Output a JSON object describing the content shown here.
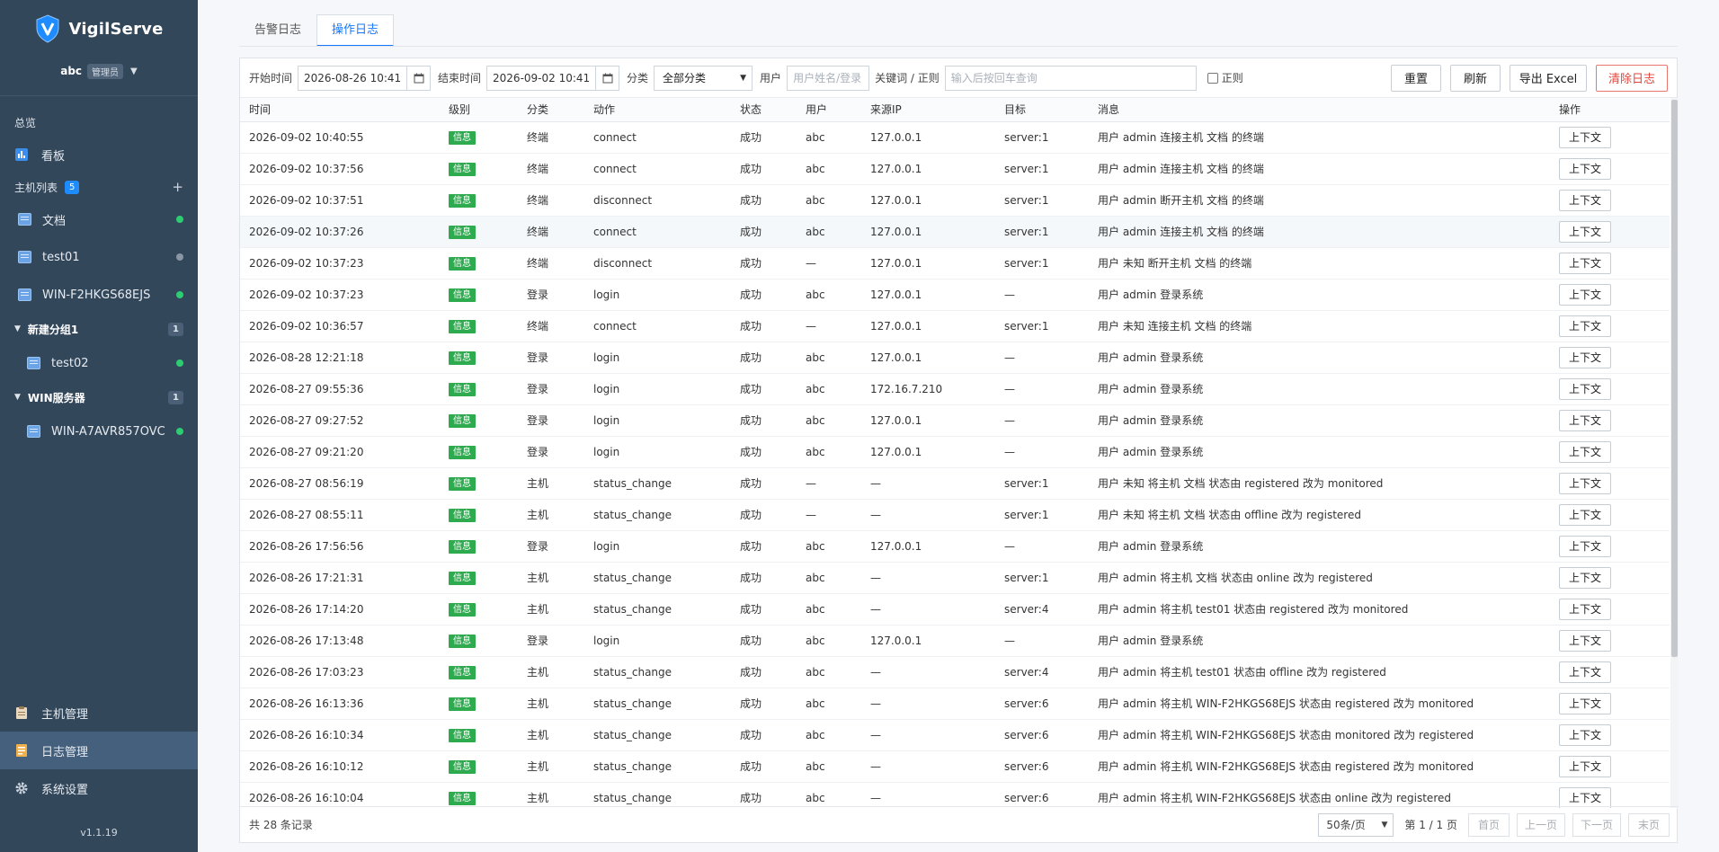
{
  "app": {
    "name": "VigilServe",
    "version": "v1.1.19"
  },
  "user": {
    "name": "abc",
    "role": "管理员"
  },
  "sidebar": {
    "overview_title": "总览",
    "dashboard_label": "看板",
    "hosts_title": "主机列表",
    "hosts_count": "5",
    "add_symbol": "+",
    "hosts": [
      {
        "name": "文档",
        "status": "online"
      },
      {
        "name": "test01",
        "status": "offline"
      },
      {
        "name": "WIN-F2HKGS68EJS",
        "status": "online"
      }
    ],
    "groups": [
      {
        "name": "新建分组1",
        "count": "1",
        "hosts": [
          {
            "name": "test02",
            "status": "online"
          }
        ]
      },
      {
        "name": "WIN服务器",
        "count": "1",
        "hosts": [
          {
            "name": "WIN-A7AVR857OVC",
            "status": "online"
          }
        ]
      }
    ],
    "bottom": [
      {
        "label": "主机管理",
        "icon": "clipboard-icon",
        "active": false
      },
      {
        "label": "日志管理",
        "icon": "log-icon",
        "active": true
      },
      {
        "label": "系统设置",
        "icon": "gear-icon",
        "active": false
      }
    ]
  },
  "tabs": [
    {
      "label": "告警日志",
      "active": false
    },
    {
      "label": "操作日志",
      "active": true
    }
  ],
  "filters": {
    "start_label": "开始时间",
    "start_value": "2026-08-26 10:41",
    "end_label": "结束时间",
    "end_value": "2026-09-02 10:41",
    "category_label": "分类",
    "category_value": "全部分类",
    "user_label": "用户",
    "user_placeholder": "用户姓名/登录",
    "keyword_label": "关键词 / 正则",
    "keyword_placeholder": "输入后按回车查询",
    "regex_label": "正则",
    "buttons": {
      "reset": "重置",
      "refresh": "刷新",
      "export": "导出 Excel",
      "clear": "清除日志"
    }
  },
  "table": {
    "columns": [
      "时间",
      "级别",
      "分类",
      "动作",
      "状态",
      "用户",
      "来源IP",
      "目标",
      "消息",
      "操作"
    ],
    "context_label": "上下文",
    "rows": [
      [
        "2026-09-02 10:40:55",
        "信息",
        "终端",
        "connect",
        "成功",
        "abc",
        "127.0.0.1",
        "server:1",
        "用户 admin 连接主机 文档 的终端"
      ],
      [
        "2026-09-02 10:37:56",
        "信息",
        "终端",
        "connect",
        "成功",
        "abc",
        "127.0.0.1",
        "server:1",
        "用户 admin 连接主机 文档 的终端"
      ],
      [
        "2026-09-02 10:37:51",
        "信息",
        "终端",
        "disconnect",
        "成功",
        "abc",
        "127.0.0.1",
        "server:1",
        "用户 admin 断开主机 文档 的终端"
      ],
      [
        "2026-09-02 10:37:26",
        "信息",
        "终端",
        "connect",
        "成功",
        "abc",
        "127.0.0.1",
        "server:1",
        "用户 admin 连接主机 文档 的终端"
      ],
      [
        "2026-09-02 10:37:23",
        "信息",
        "终端",
        "disconnect",
        "成功",
        "—",
        "127.0.0.1",
        "server:1",
        "用户 未知 断开主机 文档 的终端"
      ],
      [
        "2026-09-02 10:37:23",
        "信息",
        "登录",
        "login",
        "成功",
        "abc",
        "127.0.0.1",
        "—",
        "用户 admin 登录系统"
      ],
      [
        "2026-09-02 10:36:57",
        "信息",
        "终端",
        "connect",
        "成功",
        "—",
        "127.0.0.1",
        "server:1",
        "用户 未知 连接主机 文档 的终端"
      ],
      [
        "2026-08-28 12:21:18",
        "信息",
        "登录",
        "login",
        "成功",
        "abc",
        "127.0.0.1",
        "—",
        "用户 admin 登录系统"
      ],
      [
        "2026-08-27 09:55:36",
        "信息",
        "登录",
        "login",
        "成功",
        "abc",
        "172.16.7.210",
        "—",
        "用户 admin 登录系统"
      ],
      [
        "2026-08-27 09:27:52",
        "信息",
        "登录",
        "login",
        "成功",
        "abc",
        "127.0.0.1",
        "—",
        "用户 admin 登录系统"
      ],
      [
        "2026-08-27 09:21:20",
        "信息",
        "登录",
        "login",
        "成功",
        "abc",
        "127.0.0.1",
        "—",
        "用户 admin 登录系统"
      ],
      [
        "2026-08-27 08:56:19",
        "信息",
        "主机",
        "status_change",
        "成功",
        "—",
        "—",
        "server:1",
        "用户 未知 将主机 文档 状态由 registered 改为 monitored"
      ],
      [
        "2026-08-27 08:55:11",
        "信息",
        "主机",
        "status_change",
        "成功",
        "—",
        "—",
        "server:1",
        "用户 未知 将主机 文档 状态由 offline 改为 registered"
      ],
      [
        "2026-08-26 17:56:56",
        "信息",
        "登录",
        "login",
        "成功",
        "abc",
        "127.0.0.1",
        "—",
        "用户 admin 登录系统"
      ],
      [
        "2026-08-26 17:21:31",
        "信息",
        "主机",
        "status_change",
        "成功",
        "abc",
        "—",
        "server:1",
        "用户 admin 将主机 文档 状态由 online 改为 registered"
      ],
      [
        "2026-08-26 17:14:20",
        "信息",
        "主机",
        "status_change",
        "成功",
        "abc",
        "—",
        "server:4",
        "用户 admin 将主机 test01 状态由 registered 改为 monitored"
      ],
      [
        "2026-08-26 17:13:48",
        "信息",
        "登录",
        "login",
        "成功",
        "abc",
        "127.0.0.1",
        "—",
        "用户 admin 登录系统"
      ],
      [
        "2026-08-26 17:03:23",
        "信息",
        "主机",
        "status_change",
        "成功",
        "abc",
        "—",
        "server:4",
        "用户 admin 将主机 test01 状态由 offline 改为 registered"
      ],
      [
        "2026-08-26 16:13:36",
        "信息",
        "主机",
        "status_change",
        "成功",
        "abc",
        "—",
        "server:6",
        "用户 admin 将主机 WIN-F2HKGS68EJS 状态由 registered 改为 monitored"
      ],
      [
        "2026-08-26 16:10:34",
        "信息",
        "主机",
        "status_change",
        "成功",
        "abc",
        "—",
        "server:6",
        "用户 admin 将主机 WIN-F2HKGS68EJS 状态由 monitored 改为 registered"
      ],
      [
        "2026-08-26 16:10:12",
        "信息",
        "主机",
        "status_change",
        "成功",
        "abc",
        "—",
        "server:6",
        "用户 admin 将主机 WIN-F2HKGS68EJS 状态由 registered 改为 monitored"
      ],
      [
        "2026-08-26 16:10:04",
        "信息",
        "主机",
        "status_change",
        "成功",
        "abc",
        "—",
        "server:6",
        "用户 admin 将主机 WIN-F2HKGS68EJS 状态由 online 改为 registered"
      ]
    ]
  },
  "footer": {
    "total": "共 28 条记录",
    "page_size": "50条/页",
    "page_info": "第 1 / 1 页",
    "first": "首页",
    "prev": "上一页",
    "next": "下一页",
    "last": "末页"
  },
  "colors": {
    "sidebar_bg": "#33475b",
    "accent": "#1677ff",
    "badge_green": "#2eaa4f",
    "danger": "#e2453a",
    "online": "#2ecc71"
  }
}
